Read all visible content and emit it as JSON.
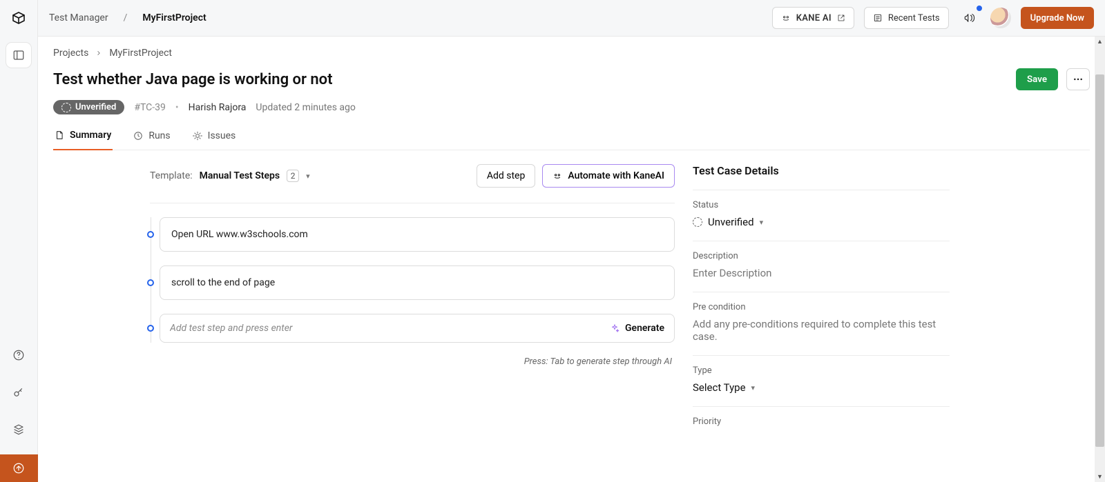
{
  "topbar": {
    "crumb_root": "Test Manager",
    "crumb_current": "MyFirstProject",
    "kane_label": "KANE AI",
    "recent_label": "Recent Tests",
    "upgrade_label": "Upgrade Now"
  },
  "breadcrumb2": {
    "root": "Projects",
    "current": "MyFirstProject"
  },
  "page": {
    "title": "Test whether Java page is working or not",
    "save_label": "Save",
    "badge_label": "Unverified",
    "tc_id": "#TC-39",
    "author": "Harish Rajora",
    "updated": "Updated 2 minutes ago"
  },
  "tabs": {
    "summary": "Summary",
    "runs": "Runs",
    "issues": "Issues"
  },
  "template": {
    "label": "Template:",
    "value": "Manual Test Steps",
    "count": "2",
    "add_step": "Add step",
    "automate": "Automate with KaneAI"
  },
  "steps": [
    {
      "text": "Open URL www.w3schools.com"
    },
    {
      "text": "scroll to the end of page"
    }
  ],
  "step_input": {
    "placeholder": "Add test step and press enter",
    "generate": "Generate",
    "tip": "Press: Tab to generate step through AI"
  },
  "right": {
    "title": "Test Case Details",
    "status_label": "Status",
    "status_value": "Unverified",
    "description_label": "Description",
    "description_placeholder": "Enter Description",
    "precond_label": "Pre condition",
    "precond_placeholder": "Add any pre-conditions required to complete this test case.",
    "type_label": "Type",
    "type_value": "Select Type",
    "priority_label": "Priority"
  }
}
